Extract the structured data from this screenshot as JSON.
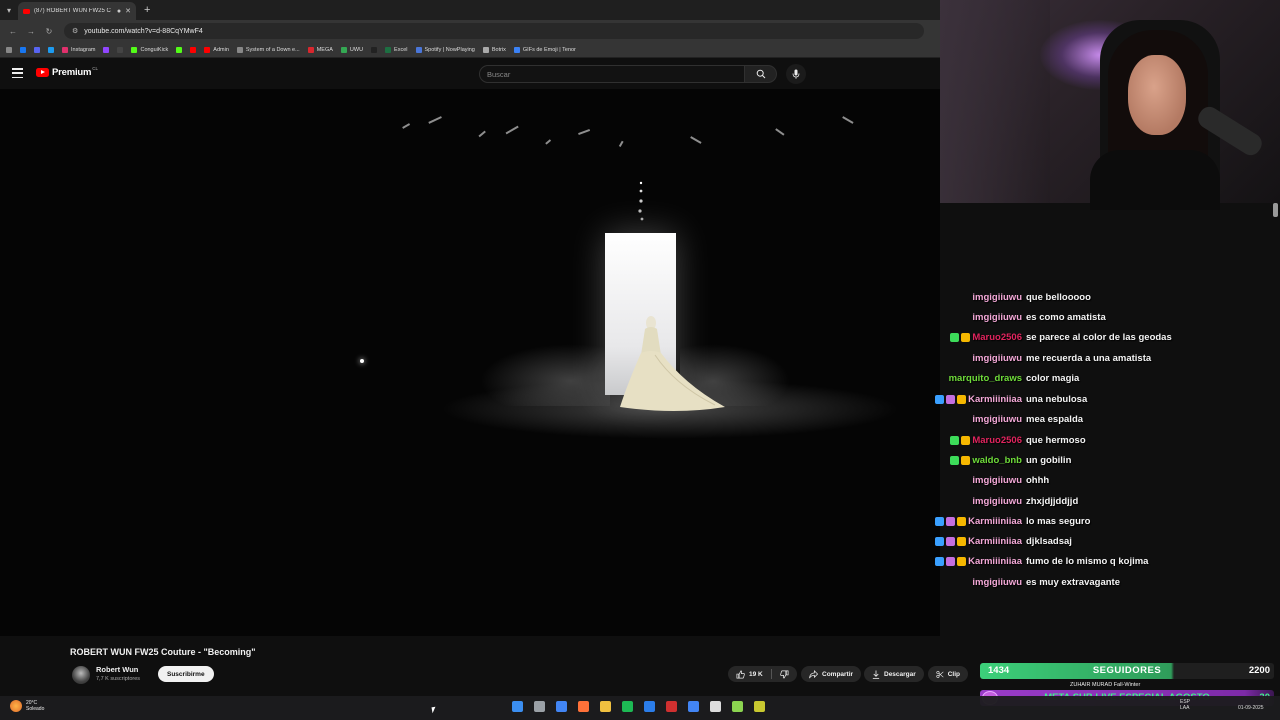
{
  "browser": {
    "tab_title": "(87) ROBERT WUN FW25 C",
    "url": "youtube.com/watch?v=d-88CqYMwF4",
    "bookmarks": [
      {
        "label": "",
        "color": "#1877f2"
      },
      {
        "label": "",
        "color": "#5865f2"
      },
      {
        "label": "",
        "color": "#1d9bf0"
      },
      {
        "label": "Instagram",
        "color": "#e1306c"
      },
      {
        "label": "",
        "color": "#9146ff"
      },
      {
        "label": "",
        "color": "#444"
      },
      {
        "label": "ConguiKick",
        "color": "#53fc18"
      },
      {
        "label": "",
        "color": "#53fc18"
      },
      {
        "label": "",
        "color": "#ff0000"
      },
      {
        "label": "Admin",
        "color": "#ff0000"
      },
      {
        "label": "System of a Down e...",
        "color": "#888"
      },
      {
        "label": "MEGA",
        "color": "#d9272e"
      },
      {
        "label": "UWU",
        "color": "#34a853"
      },
      {
        "label": "",
        "color": "#222"
      },
      {
        "label": "Excel",
        "color": "#1d6f42"
      },
      {
        "label": "Spotify | NowPlaying",
        "color": "#4a76d9"
      },
      {
        "label": "Botrix",
        "color": "#aaa"
      },
      {
        "label": "GIFs de Emoji | Tenor",
        "color": "#3b82f6"
      }
    ]
  },
  "youtube": {
    "logo_text": "Premium",
    "country_code": "CL",
    "search_placeholder": "Buscar"
  },
  "video": {
    "title": "ROBERT WUN FW25 Couture - \"Becoming\"",
    "channel": "Robert Wun",
    "subscribers": "7,7 K suscriptores",
    "subscribe_label": "Suscribirme",
    "likes": "19 K",
    "share_label": "Compartir",
    "download_label": "Descargar",
    "clip_label": "Clip"
  },
  "chat": [
    {
      "user": "imgigiiuwu",
      "text": "que bellooooo",
      "color": "#f4a9d8",
      "badges": []
    },
    {
      "user": "imgigiiuwu",
      "text": "es como amatista",
      "color": "#f4a9d8",
      "badges": []
    },
    {
      "user": "Maruo2506",
      "text": "se parece al color de las geodas",
      "color": "#e0245e",
      "badges": [
        "#3ddc5a",
        "#f5b700"
      ]
    },
    {
      "user": "imgigiiuwu",
      "text": "me recuerda a una amatista",
      "color": "#f4a9d8",
      "badges": []
    },
    {
      "user": "marquito_draws",
      "text": "color magia",
      "color": "#6fdc3a",
      "badges": []
    },
    {
      "user": "Karmiiiniiaa",
      "text": "una nebulosa",
      "color": "#f4a9d8",
      "badges": [
        "#3aa0ff",
        "#c46fe0",
        "#f5b700"
      ]
    },
    {
      "user": "imgigiiuwu",
      "text": "mea espalda",
      "color": "#f4a9d8",
      "badges": []
    },
    {
      "user": "Maruo2506",
      "text": "que hermoso",
      "color": "#e0245e",
      "badges": [
        "#3ddc5a",
        "#f5b700"
      ]
    },
    {
      "user": "waldo_bnb",
      "text": "un gobilin",
      "color": "#6fdc3a",
      "badges": [
        "#3ddc5a",
        "#f5b700"
      ]
    },
    {
      "user": "imgigiiuwu",
      "text": "ohhh",
      "color": "#f4a9d8",
      "badges": []
    },
    {
      "user": "imgigiiuwu",
      "text": "zhxjdjjddjjd",
      "color": "#f4a9d8",
      "badges": []
    },
    {
      "user": "Karmiiiniiaa",
      "text": "lo mas seguro",
      "color": "#f4a9d8",
      "badges": [
        "#3aa0ff",
        "#c46fe0",
        "#f5b700"
      ]
    },
    {
      "user": "Karmiiiniiaa",
      "text": "djklsadsaj",
      "color": "#f4a9d8",
      "badges": [
        "#3aa0ff",
        "#c46fe0",
        "#f5b700"
      ]
    },
    {
      "user": "Karmiiiniiaa",
      "text": "fumo de lo mismo q kojima",
      "color": "#f4a9d8",
      "badges": [
        "#3aa0ff",
        "#c46fe0",
        "#f5b700"
      ]
    },
    {
      "user": "imgigiiuwu",
      "text": "es muy extravagante",
      "color": "#f4a9d8",
      "badges": []
    }
  ],
  "followers": {
    "current": "1434",
    "label": "SEGUIDORES",
    "goal": "2200"
  },
  "meta": {
    "text": "META SUB LIVE ESPECIAL AGOSTO",
    "count": "30"
  },
  "tooltip_text": "ZUHAIR MURAD Fall-Winter",
  "taskbar": {
    "temperature": "20°C",
    "weather": "Soleado",
    "lang1": "ESP",
    "lang2": "LAA",
    "date": "01-09-2025",
    "apps": [
      "#3b8ef0",
      "#9aa0a6",
      "#4285f4",
      "#ff7139",
      "#f0c040",
      "#1db954",
      "#2b7de9",
      "#d03030",
      "#4285f4",
      "#ddd",
      "#8bd450",
      "#c8c830"
    ]
  }
}
